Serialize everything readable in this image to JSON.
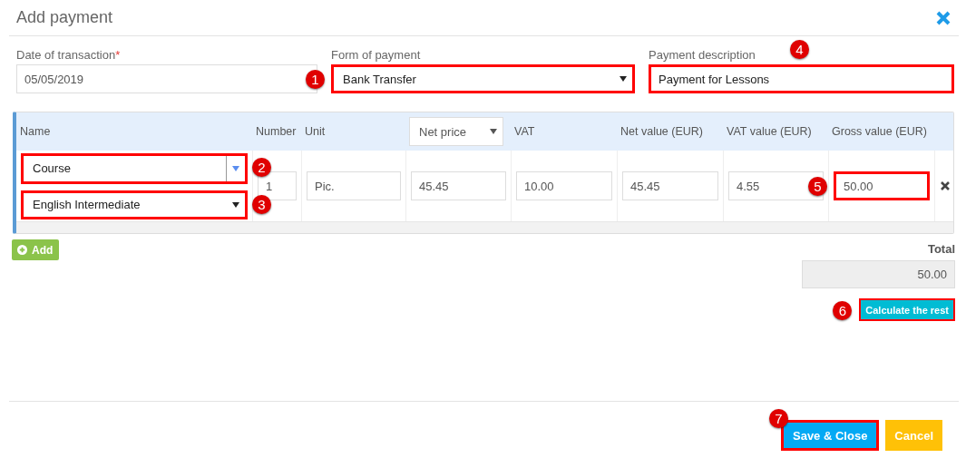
{
  "dialog": {
    "title": "Add payment"
  },
  "fields": [
    {
      "label": "Date of transaction",
      "required_mark": "*",
      "kind": "input",
      "value": "05/05/2019"
    },
    {
      "label": "Form of payment",
      "kind": "select",
      "value": "Bank Transfer",
      "callout": "1"
    },
    {
      "label": "Payment description",
      "kind": "input",
      "value": "Payment for Lessons",
      "callout": "4"
    }
  ],
  "table": {
    "columns": [
      {
        "label": "Name",
        "kind": "text"
      },
      {
        "label": "Number",
        "kind": "text"
      },
      {
        "label": "Unit",
        "kind": "text"
      },
      {
        "label": "Net price",
        "kind": "select"
      },
      {
        "label": "VAT",
        "kind": "text"
      },
      {
        "label": "Net value (EUR)",
        "kind": "text"
      },
      {
        "label": "VAT value (EUR)",
        "kind": "text"
      },
      {
        "label": "Gross value (EUR)",
        "kind": "text"
      }
    ],
    "rows": [
      {
        "cells": [
          {
            "kind": "name",
            "category": {
              "value": "Course",
              "callout": "2"
            },
            "product": {
              "value": "English Intermediate",
              "callout": "3"
            }
          },
          {
            "kind": "input",
            "value": "1"
          },
          {
            "kind": "input",
            "value": "Pic."
          },
          {
            "kind": "input",
            "value": "45.45"
          },
          {
            "kind": "input",
            "value": "10.00"
          },
          {
            "kind": "input",
            "value": "45.45"
          },
          {
            "kind": "input",
            "value": "4.55"
          },
          {
            "kind": "input",
            "value": "50.00",
            "callout": "5"
          }
        ]
      }
    ]
  },
  "add_button": {
    "label": "Add"
  },
  "total": {
    "label": "Total",
    "value": "50.00"
  },
  "calculate_button": {
    "label": "Calculate the rest",
    "callout": "6"
  },
  "footer_buttons": [
    {
      "label": "Save & Close",
      "kind": "primary",
      "callout": "7"
    },
    {
      "label": "Cancel",
      "kind": "warning"
    }
  ]
}
